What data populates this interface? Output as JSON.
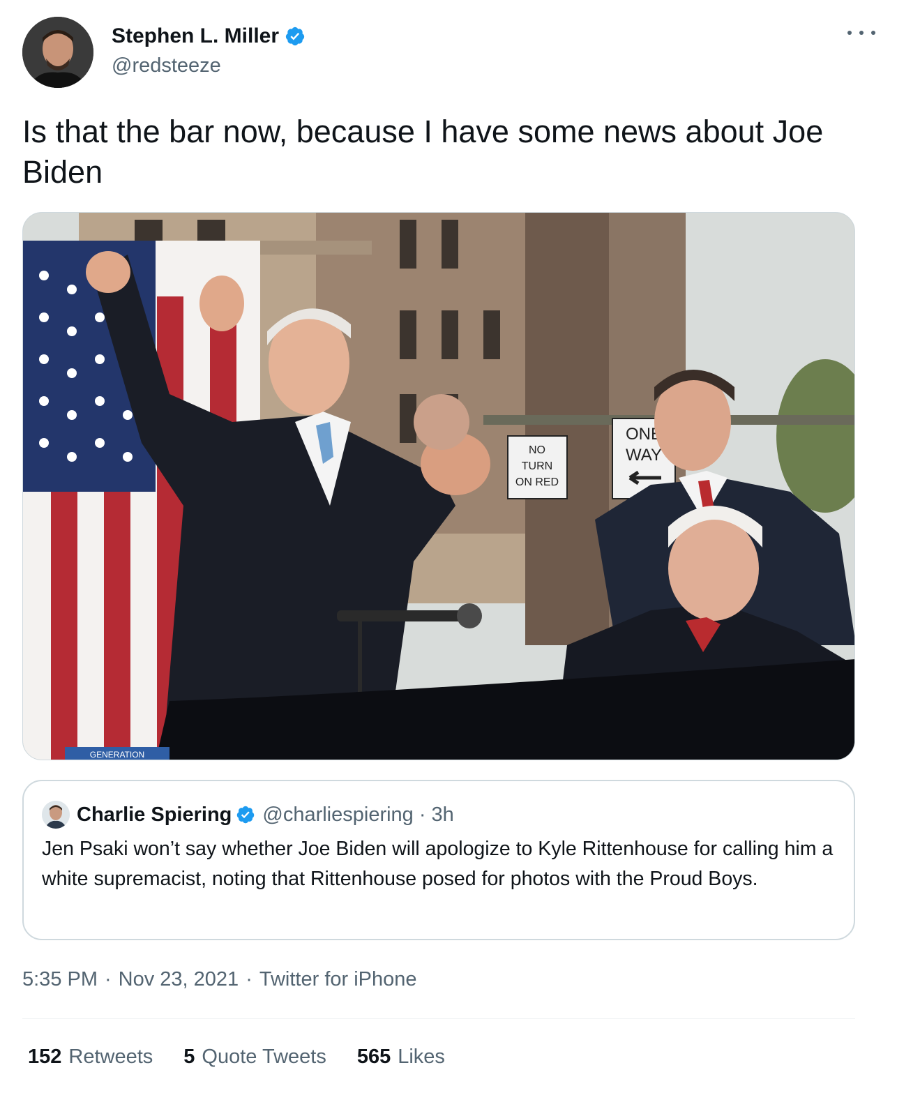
{
  "author": {
    "name": "Stephen L. Miller",
    "handle": "@redsteeze",
    "verified": true
  },
  "tweet": {
    "text": "Is that the bar now, because I have some news about Joe Biden"
  },
  "photo": {
    "sign_no_turn": [
      "NO",
      "TURN",
      "ON RED"
    ],
    "sign_one_way": [
      "ONE",
      "WAY"
    ],
    "banner_text": "GENERATION"
  },
  "quoted_tweet": {
    "name": "Charlie Spiering",
    "handle": "@charliespiering",
    "separator": "·",
    "time": "3h",
    "text": "Jen Psaki won’t say whether Joe Biden will apologize to Kyle Rittenhouse for calling him a white supremacist, noting that Rittenhouse posed for photos with the Proud Boys."
  },
  "meta": {
    "time": "5:35 PM",
    "date": "Nov 23, 2021",
    "source": "Twitter for iPhone",
    "separator": "·"
  },
  "stats": [
    {
      "count": "152",
      "label": "Retweets"
    },
    {
      "count": "5",
      "label": "Quote Tweets"
    },
    {
      "count": "565",
      "label": "Likes"
    }
  ],
  "colors": {
    "verified_blue": "#1d9bf0",
    "secondary_text": "#536471",
    "primary_text": "#0f1419",
    "border": "#cfd9de"
  },
  "icons": [
    "verified-badge-icon",
    "more-options-icon"
  ]
}
